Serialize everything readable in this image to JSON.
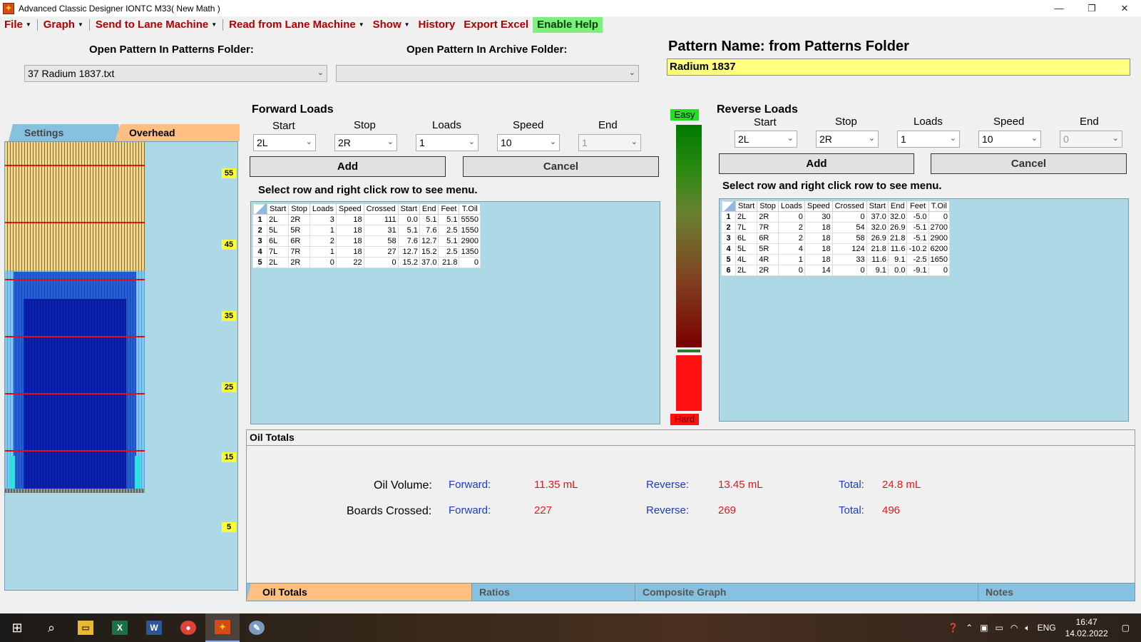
{
  "window": {
    "title": "Advanced Classic Designer IONTC M33( New Math )"
  },
  "menu": {
    "file": "File",
    "graph": "Graph",
    "send": "Send to Lane Machine",
    "read": "Read from Lane Machine",
    "show": "Show",
    "history": "History",
    "export": "Export Excel",
    "help": "Enable Help"
  },
  "open": {
    "patterns_label": "Open Pattern In Patterns Folder:",
    "patterns_value": "37 Radium 1837.txt",
    "archive_label": "Open Pattern In Archive Folder:",
    "archive_value": ""
  },
  "pattern": {
    "title": "Pattern Name: from Patterns Folder",
    "name": "Radium 1837"
  },
  "left_tabs": {
    "settings": "Settings",
    "overhead": "Overhead"
  },
  "distances": [
    "55",
    "45",
    "35",
    "25",
    "15",
    "5"
  ],
  "forward": {
    "title": "Forward Loads",
    "labels": {
      "start": "Start",
      "stop": "Stop",
      "loads": "Loads",
      "speed": "Speed",
      "end": "End"
    },
    "values": {
      "start": "2L",
      "stop": "2R",
      "loads": "1",
      "speed": "10",
      "end": "1"
    },
    "add": "Add",
    "cancel": "Cancel",
    "hint": "Select row and right click row to see menu.",
    "columns": [
      "Start",
      "Stop",
      "Loads",
      "Speed",
      "Crossed",
      "Start",
      "End",
      "Feet",
      "T.Oil"
    ],
    "rows": [
      [
        "1",
        "2L",
        "2R",
        "3",
        "18",
        "111",
        "0.0",
        "5.1",
        "5.1",
        "5550"
      ],
      [
        "2",
        "5L",
        "5R",
        "1",
        "18",
        "31",
        "5.1",
        "7.6",
        "2.5",
        "1550"
      ],
      [
        "3",
        "6L",
        "6R",
        "2",
        "18",
        "58",
        "7.6",
        "12.7",
        "5.1",
        "2900"
      ],
      [
        "4",
        "7L",
        "7R",
        "1",
        "18",
        "27",
        "12.7",
        "15.2",
        "2.5",
        "1350"
      ],
      [
        "5",
        "2L",
        "2R",
        "0",
        "22",
        "0",
        "15.2",
        "37.0",
        "21.8",
        "0"
      ]
    ]
  },
  "reverse": {
    "title": "Reverse Loads",
    "labels": {
      "start": "Start",
      "stop": "Stop",
      "loads": "Loads",
      "speed": "Speed",
      "end": "End"
    },
    "values": {
      "start": "2L",
      "stop": "2R",
      "loads": "1",
      "speed": "10",
      "end": "0"
    },
    "add": "Add",
    "cancel": "Cancel",
    "hint": "Select row and right click row to see menu.",
    "columns": [
      "Start",
      "Stop",
      "Loads",
      "Speed",
      "Crossed",
      "Start",
      "End",
      "Feet",
      "T.Oil"
    ],
    "rows": [
      [
        "1",
        "2L",
        "2R",
        "0",
        "30",
        "0",
        "37.0",
        "32.0",
        "-5.0",
        "0"
      ],
      [
        "2",
        "7L",
        "7R",
        "2",
        "18",
        "54",
        "32.0",
        "26.9",
        "-5.1",
        "2700"
      ],
      [
        "3",
        "6L",
        "6R",
        "2",
        "18",
        "58",
        "26.9",
        "21.8",
        "-5.1",
        "2900"
      ],
      [
        "4",
        "5L",
        "5R",
        "4",
        "18",
        "124",
        "21.8",
        "11.6",
        "-10.2",
        "6200"
      ],
      [
        "5",
        "4L",
        "4R",
        "1",
        "18",
        "33",
        "11.6",
        "9.1",
        "-2.5",
        "1650"
      ],
      [
        "6",
        "2L",
        "2R",
        "0",
        "14",
        "0",
        "9.1",
        "0.0",
        "-9.1",
        "0"
      ]
    ]
  },
  "meter": {
    "easy": "Easy",
    "hard": "Hard"
  },
  "totals": {
    "header": "Oil Totals",
    "oil_label": "Oil Volume:",
    "boards_label": "Boards Crossed:",
    "forward_key": "Forward:",
    "reverse_key": "Reverse:",
    "total_key": "Total:",
    "oil_forward": "11.35 mL",
    "oil_reverse": "13.45 mL",
    "oil_total": "24.8 mL",
    "boards_forward": "227",
    "boards_reverse": "269",
    "boards_total": "496"
  },
  "bottom_tabs": {
    "oil": "Oil Totals",
    "ratios": "Ratios",
    "composite": "Composite Graph",
    "notes": "Notes"
  },
  "taskbar": {
    "lang": "ENG",
    "time": "16:47",
    "date": "14.02.2022"
  }
}
